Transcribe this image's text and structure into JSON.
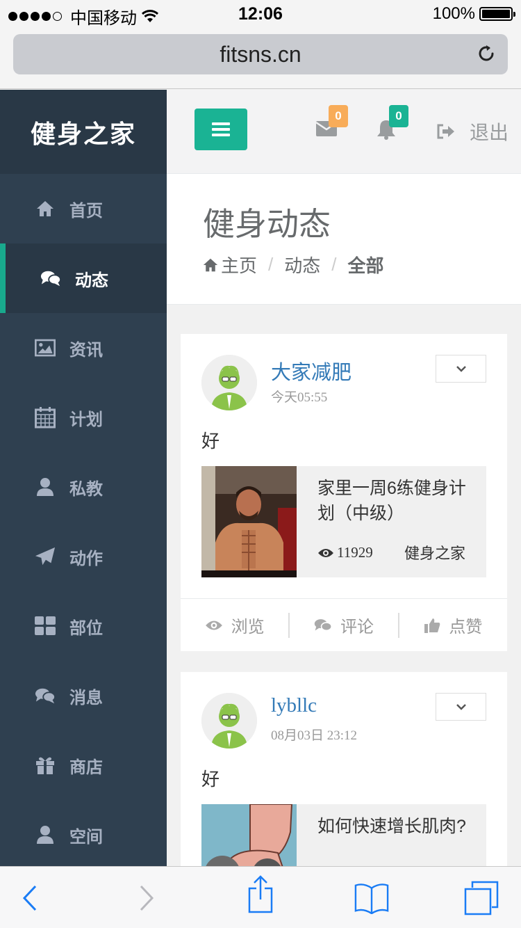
{
  "status_bar": {
    "carrier": "中国移动",
    "time": "12:06",
    "battery": "100%"
  },
  "browser": {
    "url": "fitsns.cn"
  },
  "sidebar": {
    "brand": "健身之家",
    "items": [
      {
        "label": "首页",
        "icon": "home-icon"
      },
      {
        "label": "动态",
        "icon": "comments-icon",
        "active": true
      },
      {
        "label": "资讯",
        "icon": "picture-icon"
      },
      {
        "label": "计划",
        "icon": "calendar-icon"
      },
      {
        "label": "私教",
        "icon": "user-icon"
      },
      {
        "label": "动作",
        "icon": "paper-plane-icon"
      },
      {
        "label": "部位",
        "icon": "grid-icon"
      },
      {
        "label": "消息",
        "icon": "comments-icon"
      },
      {
        "label": "商店",
        "icon": "gift-icon"
      },
      {
        "label": "空间",
        "icon": "user-icon"
      }
    ]
  },
  "topnav": {
    "mail_count": "0",
    "alert_count": "0",
    "logout_label": "退出"
  },
  "page_heading": {
    "title": "健身动态",
    "breadcrumb": [
      "主页",
      "动态",
      "全部"
    ]
  },
  "posts": [
    {
      "user": "大家减肥",
      "time": "今天05:55",
      "text": "好",
      "article": {
        "title": "家里一周6练健身计划（中级）",
        "views": "11929",
        "author": "健身之家"
      },
      "actions": [
        "浏览",
        "评论",
        "点赞"
      ]
    },
    {
      "user": "lybllc",
      "time": "08月03日 23:12",
      "text": "好",
      "article": {
        "title": "如何快速增长肌肉?"
      }
    }
  ],
  "colors": {
    "sidebar": "#2f4050",
    "accent": "#1ab394",
    "mail_badge": "#f8ac59",
    "link": "#337ab7"
  }
}
